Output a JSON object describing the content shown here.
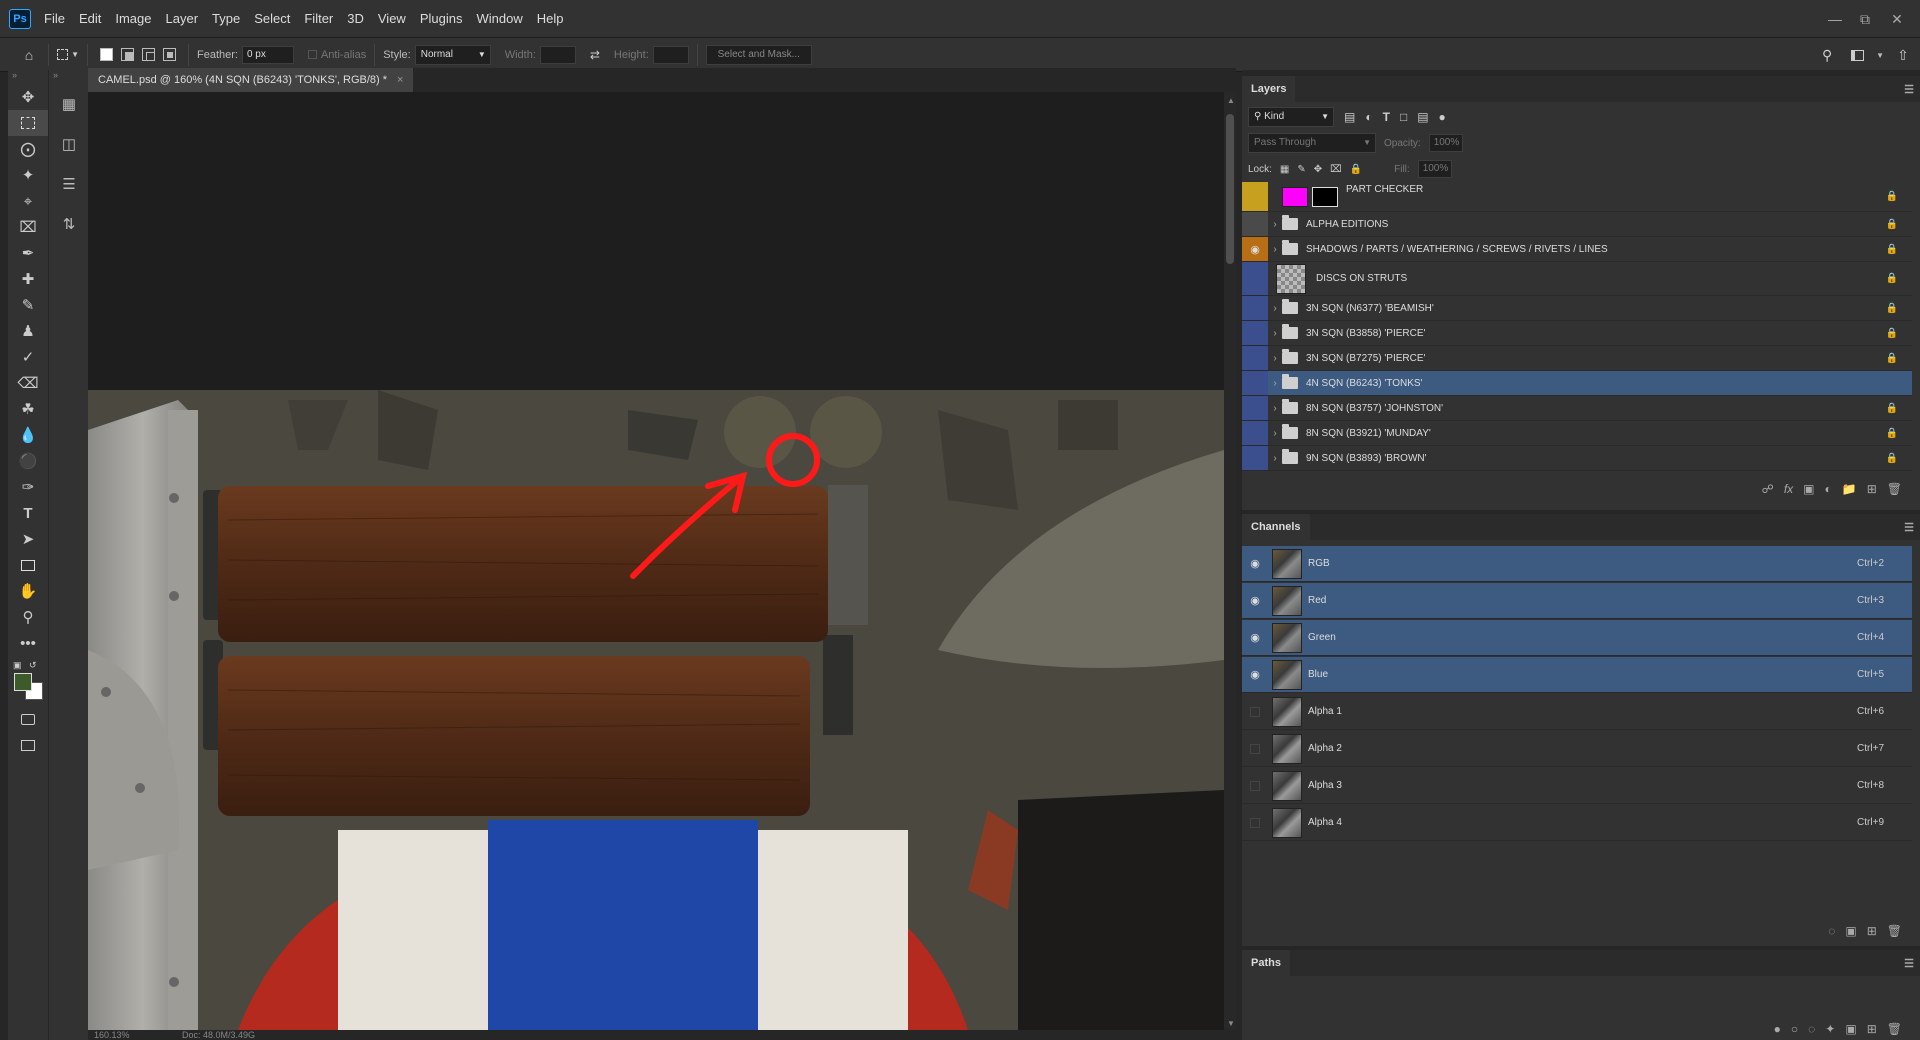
{
  "app": {
    "logo": "Ps"
  },
  "menu": [
    "File",
    "Edit",
    "Image",
    "Layer",
    "Type",
    "Select",
    "Filter",
    "3D",
    "View",
    "Plugins",
    "Window",
    "Help"
  ],
  "options": {
    "feather_label": "Feather:",
    "feather_value": "0 px",
    "antialias_label": "Anti-alias",
    "style_label": "Style:",
    "style_value": "Normal",
    "width_label": "Width:",
    "height_label": "Height:",
    "select_mask": "Select and Mask..."
  },
  "document": {
    "tab_title": "CAMEL.psd @ 160% (4N SQN (B6243) 'TONKS', RGB/8) *",
    "zoom": "160.13%",
    "doc_info": "Doc: 48.0M/3.49G"
  },
  "layers_panel": {
    "title": "Layers",
    "kind_label": "Kind",
    "blend_mode": "Pass Through",
    "opacity_label": "Opacity:",
    "opacity_value": "100%",
    "lock_label": "Lock:",
    "fill_label": "Fill:",
    "fill_value": "100%",
    "layers": [
      {
        "name": "PART CHECKER",
        "type": "fill",
        "color_tag": "#c8a020",
        "visible": false,
        "locked": true
      },
      {
        "name": "ALPHA EDITIONS",
        "type": "group",
        "color_tag": "#4a4a4a",
        "visible": false,
        "locked": true
      },
      {
        "name": "SHADOWS / PARTS / WEATHERING / SCREWS / RIVETS / LINES",
        "type": "group",
        "color_tag": "#b86e14",
        "visible": true,
        "locked": true
      },
      {
        "name": "DISCS ON STRUTS",
        "type": "pixel",
        "color_tag": "#3b4f8f",
        "visible": false,
        "locked": true
      },
      {
        "name": "3N SQN (N6377) 'BEAMISH'",
        "type": "group",
        "color_tag": "#3b4f8f",
        "visible": false,
        "locked": true
      },
      {
        "name": "3N SQN (B3858) 'PIERCE'",
        "type": "group",
        "color_tag": "#3b4f8f",
        "visible": false,
        "locked": true
      },
      {
        "name": "3N SQN (B7275) 'PIERCE'",
        "type": "group",
        "color_tag": "#3b4f8f",
        "visible": false,
        "locked": true
      },
      {
        "name": "4N SQN (B6243) 'TONKS'",
        "type": "group",
        "color_tag": "#3b4f8f",
        "visible": false,
        "locked": false,
        "selected": true
      },
      {
        "name": "8N SQN (B3757) 'JOHNSTON'",
        "type": "group",
        "color_tag": "#3b4f8f",
        "visible": false,
        "locked": true
      },
      {
        "name": "8N SQN (B3921) 'MUNDAY'",
        "type": "group",
        "color_tag": "#3b4f8f",
        "visible": false,
        "locked": true
      },
      {
        "name": "9N SQN (B3893) 'BROWN'",
        "type": "group",
        "color_tag": "#3b4f8f",
        "visible": false,
        "locked": true
      }
    ]
  },
  "channels_panel": {
    "title": "Channels",
    "channels": [
      {
        "name": "RGB",
        "shortcut": "Ctrl+2",
        "visible": true,
        "selected": true
      },
      {
        "name": "Red",
        "shortcut": "Ctrl+3",
        "visible": true,
        "selected": true
      },
      {
        "name": "Green",
        "shortcut": "Ctrl+4",
        "visible": true,
        "selected": true
      },
      {
        "name": "Blue",
        "shortcut": "Ctrl+5",
        "visible": true,
        "selected": true
      },
      {
        "name": "Alpha 1",
        "shortcut": "Ctrl+6",
        "visible": false,
        "selected": false
      },
      {
        "name": "Alpha 2",
        "shortcut": "Ctrl+7",
        "visible": false,
        "selected": false
      },
      {
        "name": "Alpha 3",
        "shortcut": "Ctrl+8",
        "visible": false,
        "selected": false
      },
      {
        "name": "Alpha 4",
        "shortcut": "Ctrl+9",
        "visible": false,
        "selected": false
      }
    ]
  },
  "paths_panel": {
    "title": "Paths"
  },
  "colors": {
    "foreground": "#3c5a2a",
    "background": "#ffffff",
    "selection": "#3d5a80",
    "annotation": "#ff1a1a"
  }
}
